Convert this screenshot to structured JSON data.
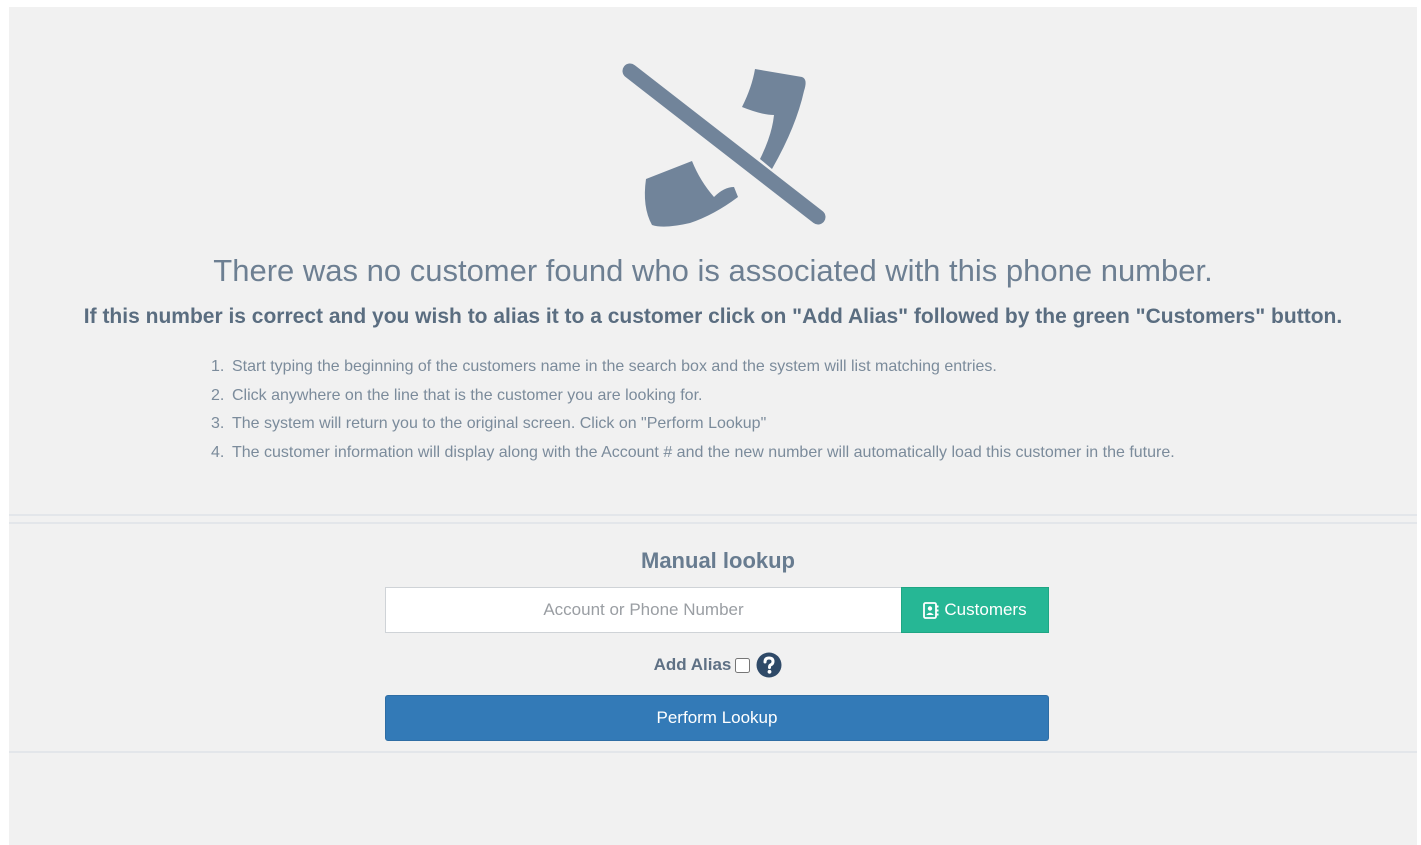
{
  "message": {
    "title": "There was no customer found who is associated with this phone number.",
    "subtitle": "If this number is correct and you wish to alias it to a customer click on \"Add Alias\" followed by the green \"Customers\" button.",
    "steps": [
      {
        "num": "1.",
        "text": "Start typing the beginning of the customers name in the search box and the system will list matching entries."
      },
      {
        "num": "2.",
        "text": "Click anywhere on the line that is the customer you are looking for."
      },
      {
        "num": "3.",
        "text": "The system will return you to the original screen. Click on \"Perform Lookup\""
      },
      {
        "num": "4.",
        "text": "The customer information will display along with the Account # and the new number will automatically load this customer in the future."
      }
    ],
    "icon": "phone-slash-icon"
  },
  "lookup": {
    "title": "Manual lookup",
    "input_placeholder": "Account or Phone Number",
    "input_value": "",
    "customers_label": "Customers",
    "customers_icon": "address-book-icon",
    "add_alias_label": "Add Alias",
    "add_alias_checked": false,
    "help_icon": "question-circle-icon",
    "perform_label": "Perform Lookup"
  },
  "colors": {
    "page_background": "#f1f1f1",
    "icon_gray": "#71849a",
    "customers_green": "#26b795",
    "perform_blue": "#337ab7",
    "help_blue": "#2f4a68"
  }
}
